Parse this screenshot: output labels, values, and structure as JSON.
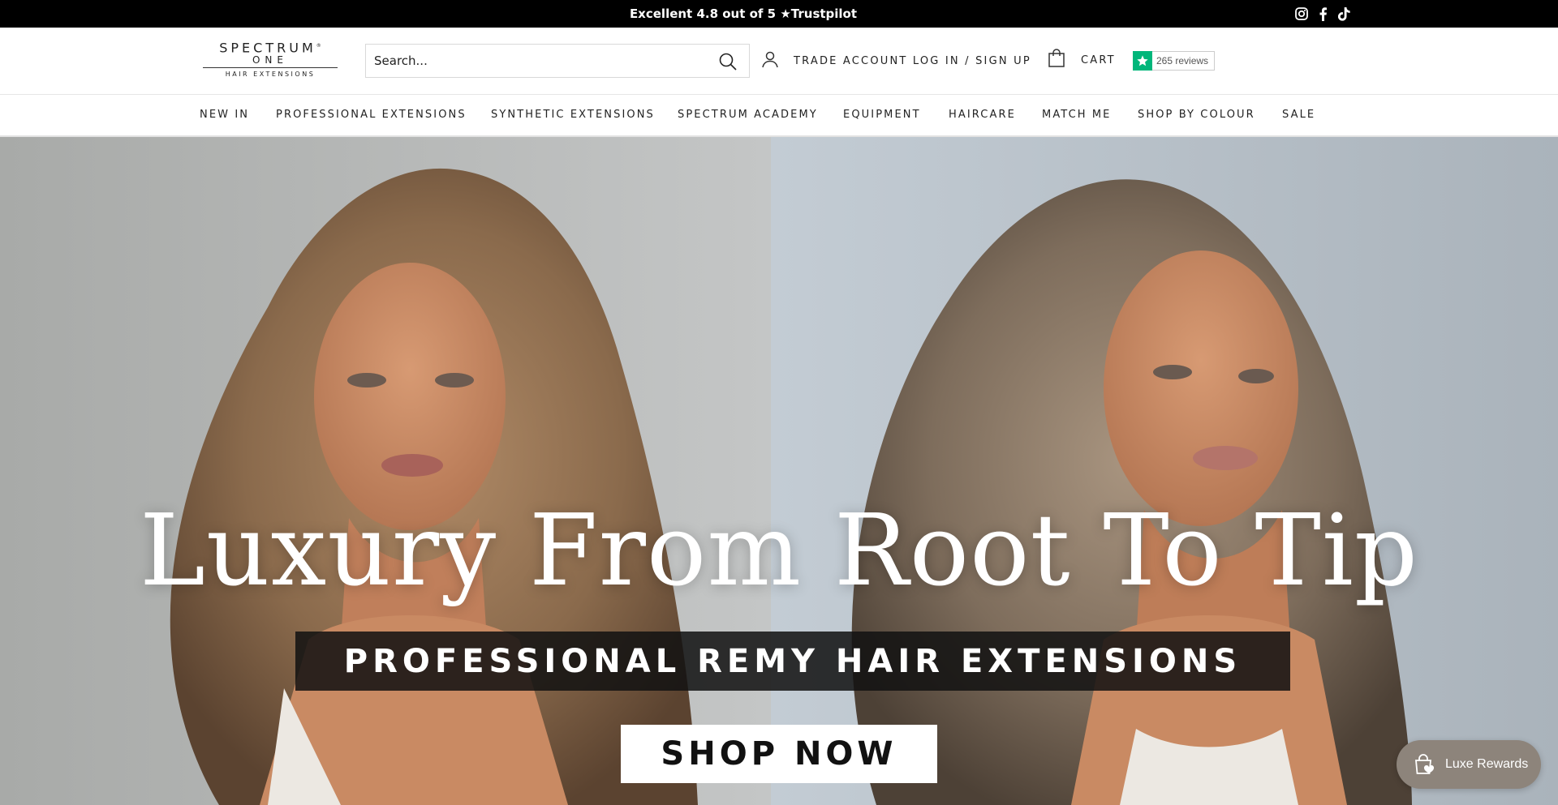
{
  "announcement": {
    "text": "Excellent 4.8 out of 5 ★Trustpilot",
    "social_icons": [
      "instagram-icon",
      "facebook-icon",
      "tiktok-icon"
    ]
  },
  "header": {
    "logo": {
      "line1": "SPECTRUM",
      "line2": "ONE",
      "line3": "HAIR EXTENSIONS"
    },
    "search": {
      "placeholder": "Search...",
      "icon": "search-icon"
    },
    "account": {
      "label": "TRADE ACCOUNT LOG IN / SIGN UP",
      "icon": "user-icon"
    },
    "cart": {
      "label": "CART",
      "icon": "bag-icon"
    },
    "trustpilot": {
      "reviews": "265 reviews",
      "color": "#00b67a"
    }
  },
  "nav": {
    "items": [
      "NEW IN",
      "PROFESSIONAL EXTENSIONS",
      "SYNTHETIC EXTENSIONS",
      "SPECTRUM ACADEMY",
      "EQUIPMENT",
      "HAIRCARE",
      "MATCH ME",
      "SHOP BY COLOUR",
      "SALE"
    ]
  },
  "hero": {
    "title": "Luxury From Root To Tip",
    "subtitle": "PROFESSIONAL REMY HAIR EXTENSIONS",
    "cta": "SHOP NOW"
  },
  "rewards": {
    "label": "Luxe Rewards",
    "icon": "shopping-bag-heart-icon",
    "color": "#8d847b"
  }
}
